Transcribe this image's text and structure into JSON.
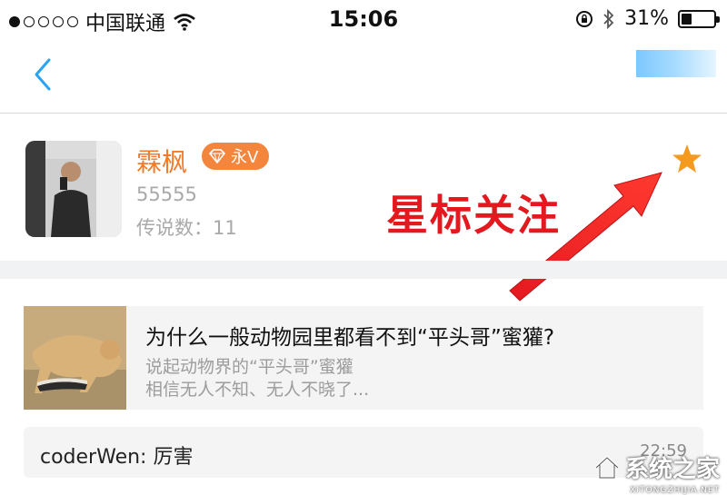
{
  "status_bar": {
    "carrier": "中国联通",
    "time": "15:06",
    "battery_percent": "31%",
    "battery_level": 0.31
  },
  "profile": {
    "name": "霖枫",
    "badge": "永V",
    "id": "55555",
    "legend_count": "传说数：11"
  },
  "annotation": {
    "text": "星标关注",
    "color": "#e4191f"
  },
  "story": {
    "title": "为什么一般动物园里都看不到“平头哥”蜜獾?",
    "desc_line1": "说起动物界的“平头哥”蜜獾",
    "desc_line2": "相信无人不知、无人不晓了..."
  },
  "comment": {
    "text": "coderWen: 厉害",
    "time": "22:59"
  },
  "watermark": {
    "text": "系统之家",
    "sub": "XITONGZHIJIA.NET"
  },
  "colors": {
    "accent_blue": "#2aa3f0",
    "name_orange": "#f07b2a",
    "star_orange": "#f49a1e"
  }
}
